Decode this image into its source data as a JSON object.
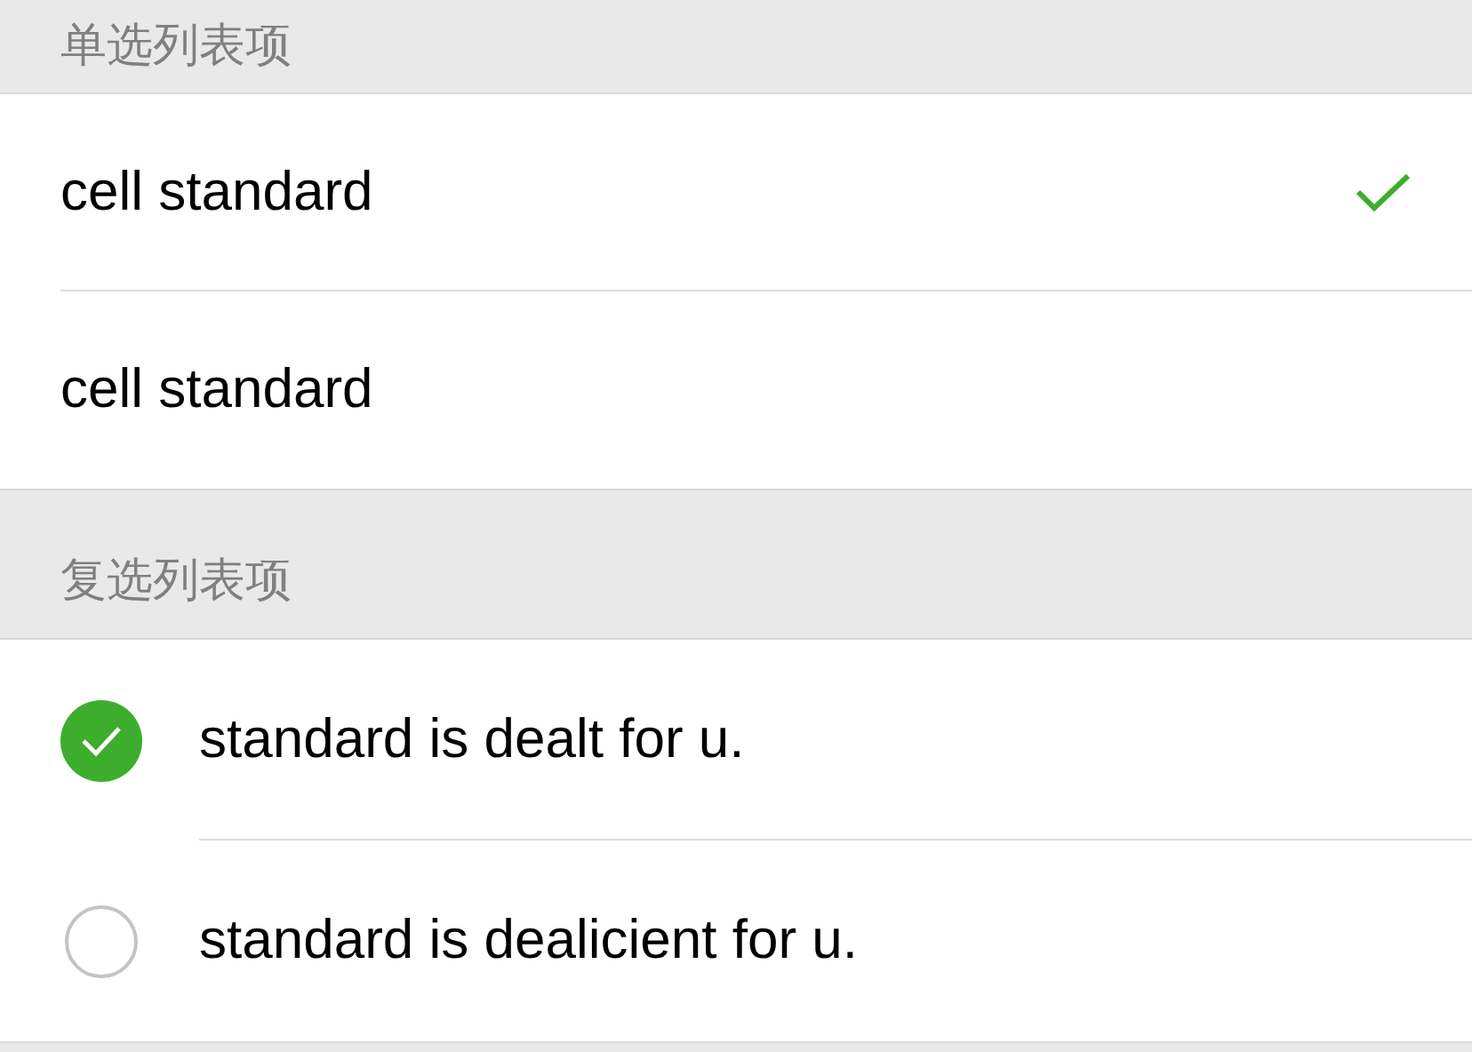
{
  "radio_section": {
    "title": "单选列表项",
    "items": [
      {
        "label": "cell standard",
        "selected": true
      },
      {
        "label": "cell standard",
        "selected": false
      }
    ]
  },
  "checkbox_section": {
    "title": "复选列表项",
    "items": [
      {
        "label": "standard is dealt for u.",
        "checked": true
      },
      {
        "label": "standard is dealicient for u.",
        "checked": false
      }
    ]
  }
}
